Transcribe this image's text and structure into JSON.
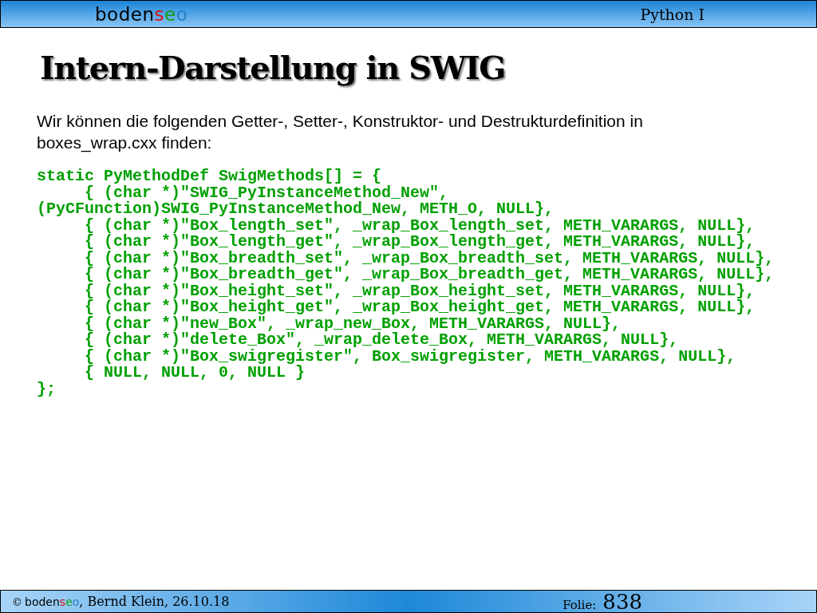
{
  "header": {
    "logo": [
      {
        "text": "boden",
        "color": "#000000"
      },
      {
        "text": "s",
        "color": "#e01010"
      },
      {
        "text": "e",
        "color": "#10a010"
      },
      {
        "text": "o",
        "color": "#2080c8"
      }
    ],
    "course": "Python I"
  },
  "slide": {
    "title": "Intern-Darstellung in SWIG",
    "intro": "Wir können die folgenden Getter-, Setter-, Konstruktor- und Destrukturdefinition in boxes_wrap.cxx finden:",
    "code": [
      "static PyMethodDef SwigMethods[] = {",
      "     { (char *)\"SWIG_PyInstanceMethod_New\",",
      "(PyCFunction)SWIG_PyInstanceMethod_New, METH_O, NULL},",
      "     { (char *)\"Box_length_set\", _wrap_Box_length_set, METH_VARARGS, NULL},",
      "     { (char *)\"Box_length_get\", _wrap_Box_length_get, METH_VARARGS, NULL},",
      "     { (char *)\"Box_breadth_set\", _wrap_Box_breadth_set, METH_VARARGS, NULL},",
      "     { (char *)\"Box_breadth_get\", _wrap_Box_breadth_get, METH_VARARGS, NULL},",
      "     { (char *)\"Box_height_set\", _wrap_Box_height_set, METH_VARARGS, NULL},",
      "     { (char *)\"Box_height_get\", _wrap_Box_height_get, METH_VARARGS, NULL},",
      "     { (char *)\"new_Box\", _wrap_new_Box, METH_VARARGS, NULL},",
      "     { (char *)\"delete_Box\", _wrap_delete_Box, METH_VARARGS, NULL},",
      "     { (char *)\"Box_swigregister\", Box_swigregister, METH_VARARGS, NULL},",
      "     { NULL, NULL, 0, NULL }",
      "};"
    ]
  },
  "footer": {
    "copyright": "©",
    "logo": [
      {
        "text": "boden",
        "color": "#000000"
      },
      {
        "text": "s",
        "color": "#e01010"
      },
      {
        "text": "e",
        "color": "#10a010"
      },
      {
        "text": "o",
        "color": "#2080c8"
      }
    ],
    "credit": ", Bernd Klein, 26.10.18",
    "folio_label": "Folie:",
    "folio": "838"
  }
}
